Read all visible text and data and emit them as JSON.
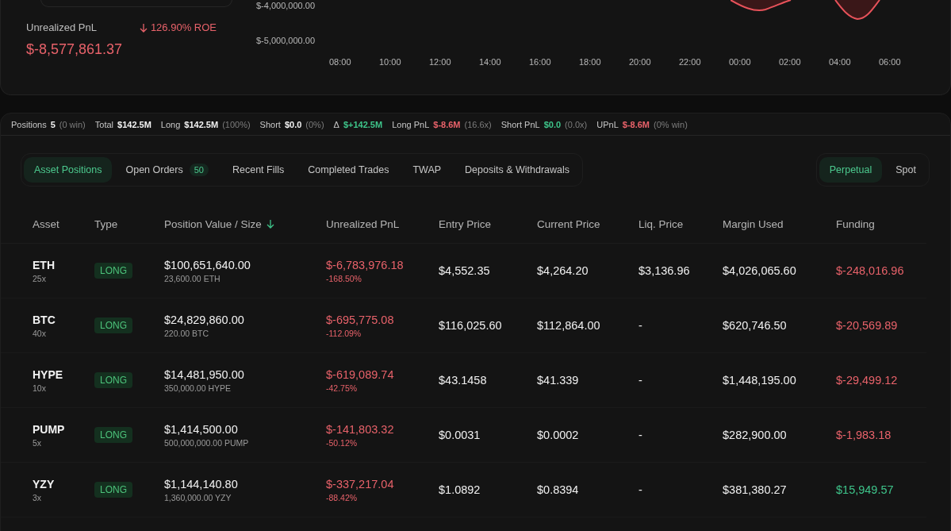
{
  "summary": {
    "label": "Unrealized PnL",
    "roe": "126.90% ROE",
    "value": "$-8,577,861.37",
    "color": "#e8626a"
  },
  "pnl_chart": {
    "y_labels": [
      "$-4,000,000.00",
      "$-5,000,000.00"
    ],
    "x_labels": [
      "08:00",
      "10:00",
      "12:00",
      "14:00",
      "16:00",
      "18:00",
      "20:00",
      "22:00",
      "00:00",
      "02:00",
      "04:00",
      "06:00"
    ]
  },
  "stats": [
    {
      "label": "Positions",
      "value": "5",
      "note": "(0 win)",
      "color": "#f2f2f2"
    },
    {
      "label": "Total",
      "value": "$142.5M",
      "color": "#f2f2f2"
    },
    {
      "label": "Long",
      "value": "$142.5M",
      "note": "(100%)",
      "color": "#f2f2f2"
    },
    {
      "label": "Short",
      "value": "$0.0",
      "note": "(0%)",
      "color": "#f2f2f2"
    },
    {
      "label": "Δ",
      "value": "$+142.5M",
      "color": "#3ec48a"
    },
    {
      "label": "Long PnL",
      "value": "$-8.6M",
      "note": "(16.6x)",
      "color": "#e8626a"
    },
    {
      "label": "Short PnL",
      "value": "$0.0",
      "note": "(0.0x)",
      "color": "#3ec48a"
    },
    {
      "label": "UPnL",
      "value": "$-8.6M",
      "note": "(0% win)",
      "color": "#e8626a"
    }
  ],
  "tabs": [
    {
      "label": "Asset Positions",
      "selected": true
    },
    {
      "label": "Open Orders",
      "badge": "50",
      "selected": false
    },
    {
      "label": "Recent Fills",
      "selected": false
    },
    {
      "label": "Completed Trades",
      "selected": false
    },
    {
      "label": "TWAP",
      "selected": false
    },
    {
      "label": "Deposits & Withdrawals",
      "selected": false
    }
  ],
  "market_toggle": [
    {
      "label": "Perpetual",
      "selected": true
    },
    {
      "label": "Spot",
      "selected": false
    }
  ],
  "table": {
    "columns": [
      {
        "label": "Asset",
        "sorted": false
      },
      {
        "label": "Type",
        "sorted": false
      },
      {
        "label": "Position Value / Size",
        "sorted": true
      },
      {
        "label": "Unrealized PnL",
        "sorted": false
      },
      {
        "label": "Entry Price",
        "sorted": false
      },
      {
        "label": "Current Price",
        "sorted": false
      },
      {
        "label": "Liq. Price",
        "sorted": false
      },
      {
        "label": "Margin Used",
        "sorted": false
      },
      {
        "label": "Funding",
        "sorted": false
      }
    ],
    "rows": [
      {
        "asset": "ETH",
        "leverage": "25x",
        "type": "LONG",
        "position_value": "$100,651,640.00",
        "size": "23,600.00 ETH",
        "unrealized_pnl": {
          "value": "$-6,783,976.18",
          "pct": "-168.50%",
          "color": "#e8626a"
        },
        "entry_price": "$4,552.35",
        "current_price": "$4,264.20",
        "liq_price": "$3,136.96",
        "margin_used": "$4,026,065.60",
        "funding": {
          "value": "$-248,016.96",
          "color": "#e8626a"
        }
      },
      {
        "asset": "BTC",
        "leverage": "40x",
        "type": "LONG",
        "position_value": "$24,829,860.00",
        "size": "220.00 BTC",
        "unrealized_pnl": {
          "value": "$-695,775.08",
          "pct": "-112.09%",
          "color": "#e8626a"
        },
        "entry_price": "$116,025.60",
        "current_price": "$112,864.00",
        "liq_price": "-",
        "margin_used": "$620,746.50",
        "funding": {
          "value": "$-20,569.89",
          "color": "#e8626a"
        }
      },
      {
        "asset": "HYPE",
        "leverage": "10x",
        "type": "LONG",
        "position_value": "$14,481,950.00",
        "size": "350,000.00 HYPE",
        "unrealized_pnl": {
          "value": "$-619,089.74",
          "pct": "-42.75%",
          "color": "#e8626a"
        },
        "entry_price": "$43.1458",
        "current_price": "$41.339",
        "liq_price": "-",
        "margin_used": "$1,448,195.00",
        "funding": {
          "value": "$-29,499.12",
          "color": "#e8626a"
        }
      },
      {
        "asset": "PUMP",
        "leverage": "5x",
        "type": "LONG",
        "position_value": "$1,414,500.00",
        "size": "500,000,000.00 PUMP",
        "unrealized_pnl": {
          "value": "$-141,803.32",
          "pct": "-50.12%",
          "color": "#e8626a"
        },
        "entry_price": "$0.0031",
        "current_price": "$0.0002",
        "liq_price": "-",
        "margin_used": "$282,900.00",
        "funding": {
          "value": "$-1,983.18",
          "color": "#e8626a"
        }
      },
      {
        "asset": "YZY",
        "leverage": "3x",
        "type": "LONG",
        "position_value": "$1,144,140.80",
        "size": "1,360,000.00 YZY",
        "unrealized_pnl": {
          "value": "$-337,217.04",
          "pct": "-88.42%",
          "color": "#e8626a"
        },
        "entry_price": "$1.0892",
        "current_price": "$0.8394",
        "liq_price": "-",
        "margin_used": "$381,380.27",
        "funding": {
          "value": "$15,949.57",
          "color": "#3ec48a"
        }
      }
    ]
  }
}
